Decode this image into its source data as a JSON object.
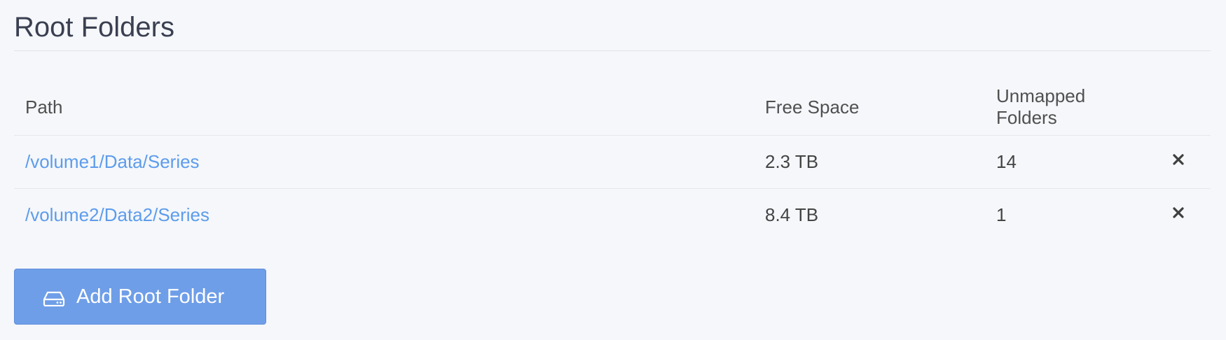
{
  "section": {
    "title": "Root Folders"
  },
  "table": {
    "headers": {
      "path": "Path",
      "free_space": "Free Space",
      "unmapped_folders": "Unmapped Folders"
    },
    "rows": [
      {
        "path": "/volume1/Data/Series",
        "free_space": "2.3 TB",
        "unmapped_folders": "14",
        "remove_icon": "close-icon"
      },
      {
        "path": "/volume2/Data2/Series",
        "free_space": "8.4 TB",
        "unmapped_folders": "1",
        "remove_icon": "close-icon"
      }
    ]
  },
  "actions": {
    "add_root_folder_label": "Add Root Folder",
    "add_root_folder_icon": "hard-drive-icon"
  },
  "colors": {
    "link": "#5d9cec",
    "button_bg": "#6f9ee8",
    "page_bg": "#f5f7fa"
  }
}
